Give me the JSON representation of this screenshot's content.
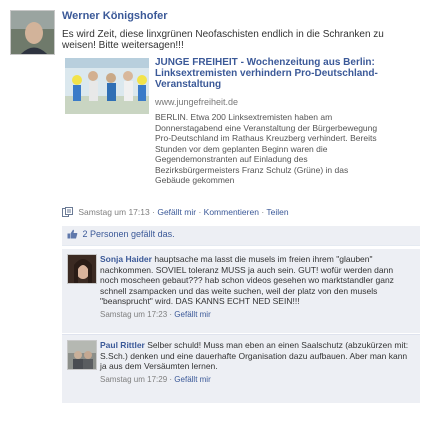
{
  "post": {
    "author": "Werner Königshofer",
    "text": "Es wird Zeit, diese linxgrünen Neofaschisten endlich in die Schranken zu weisen! Bitte weitersagen!!!"
  },
  "link": {
    "title": "JUNGE FREIHEIT - Wochenzeitung aus Berlin: Linksextremisten verhindern Pro-Deutschland-Veranstaltung",
    "url": "www.jungefreiheit.de",
    "description": "BERLIN. Etwa 200 Linksextremisten haben am Donnerstagabend eine Veranstaltung der Bürgerbewegung Pro-Deutschland im Rathaus Kreuzberg verhindert. Bereits Stunden vor dem geplanten Beginn waren die Gegendemonstranten auf Einladung des Bezirksbürgermeisters Franz Schulz (Grüne) in das Gebäude gekommen"
  },
  "actions": {
    "timestamp": "Samstag um 17:13",
    "sep": "·",
    "like": "Gefällt mir",
    "comments": "Kommentieren",
    "share": "Teilen"
  },
  "likes": {
    "text": "2 Personen gefällt das."
  },
  "comments": [
    {
      "author": "Sonja Haider",
      "text": "hauptsache ma lasst die musels im freien ihrem \"glauben\" nachkommen. SOVIEL toleranz MUSS ja auch sein. GUT! wofür werden dann noch moscheen gebaut??? hab schon videos gesehen wo marktstandler ganz schnell zsampacken und das weite suchen, weil der platz von den musels \"beansprucht\" wird. DAS KANNS ECHT NED SEIN!!!",
      "timestamp": "Samstag um 17:23",
      "like": "Gefällt mir"
    },
    {
      "author": "Paul Rittler",
      "text": "Selber schuld! Muss man eben an einen Saalschutz (abzukürzen mit: S.Sch.) denken und eine dauerhafte Organisation dazu aufbauen. Aber man kann ja aus dem Versäumten lernen.",
      "timestamp": "Samstag um 17:29",
      "like": "Gefällt mir"
    }
  ],
  "colors": {
    "link": "#3b5998",
    "comment_bg": "#edeff4"
  },
  "icons": {
    "post_type": "link-share-icon",
    "like": "thumbs-up-icon"
  }
}
